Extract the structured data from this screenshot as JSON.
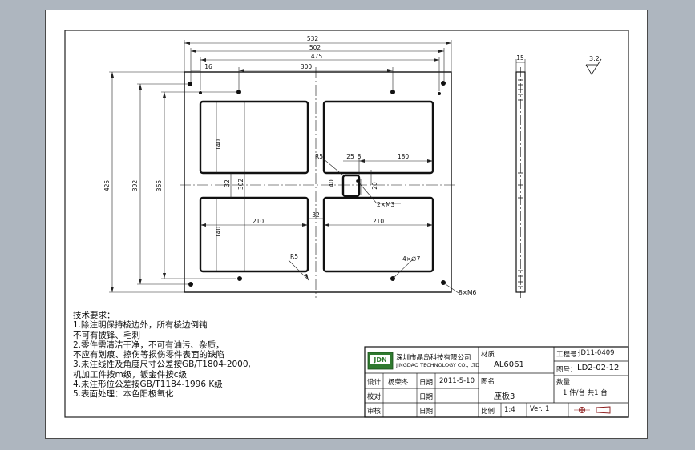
{
  "dimensions": {
    "d532": "532",
    "d502": "502",
    "d475": "475",
    "d300": "300",
    "d16": "16",
    "d15": "15",
    "d425": "425",
    "d392": "392",
    "d365": "365",
    "d140a": "140",
    "d140b": "140",
    "d32v": "32",
    "d302": "302",
    "d32h": "32",
    "d210a": "210",
    "d210b": "210",
    "d180": "180",
    "d25": "25",
    "d8": "8",
    "d40": "40",
    "d20": "20",
    "r5a": "R5",
    "r5b": "R5",
    "m3": "2×M3",
    "holes7": "4×∅7",
    "m6": "8×M6",
    "roughness": "3.2"
  },
  "notes": {
    "title": "技术要求：",
    "lines": [
      "1.除注明保持棱边外，所有棱边倒钝",
      "  不可有披锋、毛刺",
      "2.零件需清洁干净，不可有油污、杂质，",
      "  不应有划痕、擦伤等损伤零件表面的缺陷",
      "3.未注线性及角度尺寸公差按GB/T1804-2000,",
      "  机加工件按m级，钣金件按c级",
      "4.未注形位公差按GB/T1184-1996 K级",
      "5.表面处理：本色阳极氧化"
    ]
  },
  "titleblock": {
    "logo_text": "JDN",
    "company_cn": "深圳市晶岛科技有限公司",
    "company_en": "JINGDAO TECHNOLOGY CO., LTD",
    "material_label": "材质",
    "material": "AL6061",
    "project_label": "工程号：",
    "project": "JD11-0409",
    "drawing_no_label": "图号：",
    "drawing_no": "LD2-02-12",
    "quantity_label": "数量",
    "quantity": "1  件/台    共1  台",
    "design_label": "设计",
    "designer": "杨荣冬",
    "date_label": "日期",
    "date": "2011-5-10",
    "name_label": "图名",
    "part_name": "座板3",
    "check_label": "校对",
    "date_label2": "日期",
    "approve_label": "审核",
    "date_label3": "日期",
    "scale_label": "比例",
    "scale": "1:4",
    "version_label": "Ver.",
    "version": "1"
  }
}
